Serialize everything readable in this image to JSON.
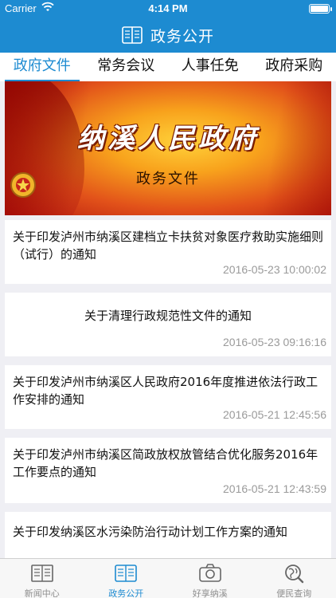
{
  "status_bar": {
    "carrier": "Carrier",
    "time": "4:14 PM"
  },
  "nav": {
    "title": "政务公开"
  },
  "tabs": [
    {
      "label": "政府文件",
      "active": true
    },
    {
      "label": "常务会议",
      "active": false
    },
    {
      "label": "人事任免",
      "active": false
    },
    {
      "label": "政府采购",
      "active": false
    }
  ],
  "banner": {
    "title": "纳溪人民政府",
    "subtitle": "政务文件"
  },
  "articles": [
    {
      "title": "关于印发泸州市纳溪区建档立卡扶贫对象医疗救助实施细则（试行）的通知",
      "date": "2016-05-23 10:00:02"
    },
    {
      "title": "关于清理行政规范性文件的通知",
      "date": "2016-05-23 09:16:16"
    },
    {
      "title": "关于印发泸州市纳溪区人民政府2016年度推进依法行政工作安排的通知",
      "date": "2016-05-21 12:45:56"
    },
    {
      "title": "关于印发泸州市纳溪区简政放权放管结合优化服务2016年工作要点的通知",
      "date": "2016-05-21 12:43:59"
    },
    {
      "title": "关于印发纳溪区水污染防治行动计划工作方案的通知",
      "date": ""
    }
  ],
  "tabbar": [
    {
      "label": "新闻中心",
      "icon": "newspaper-icon",
      "active": false
    },
    {
      "label": "政务公开",
      "icon": "book-icon",
      "active": true
    },
    {
      "label": "好享纳溪",
      "icon": "camera-icon",
      "active": false
    },
    {
      "label": "便民查询",
      "icon": "globe-search-icon",
      "active": false
    }
  ],
  "colors": {
    "brand": "#1d8bd1",
    "background": "#efeff4",
    "date_text": "#9a9a9a"
  }
}
